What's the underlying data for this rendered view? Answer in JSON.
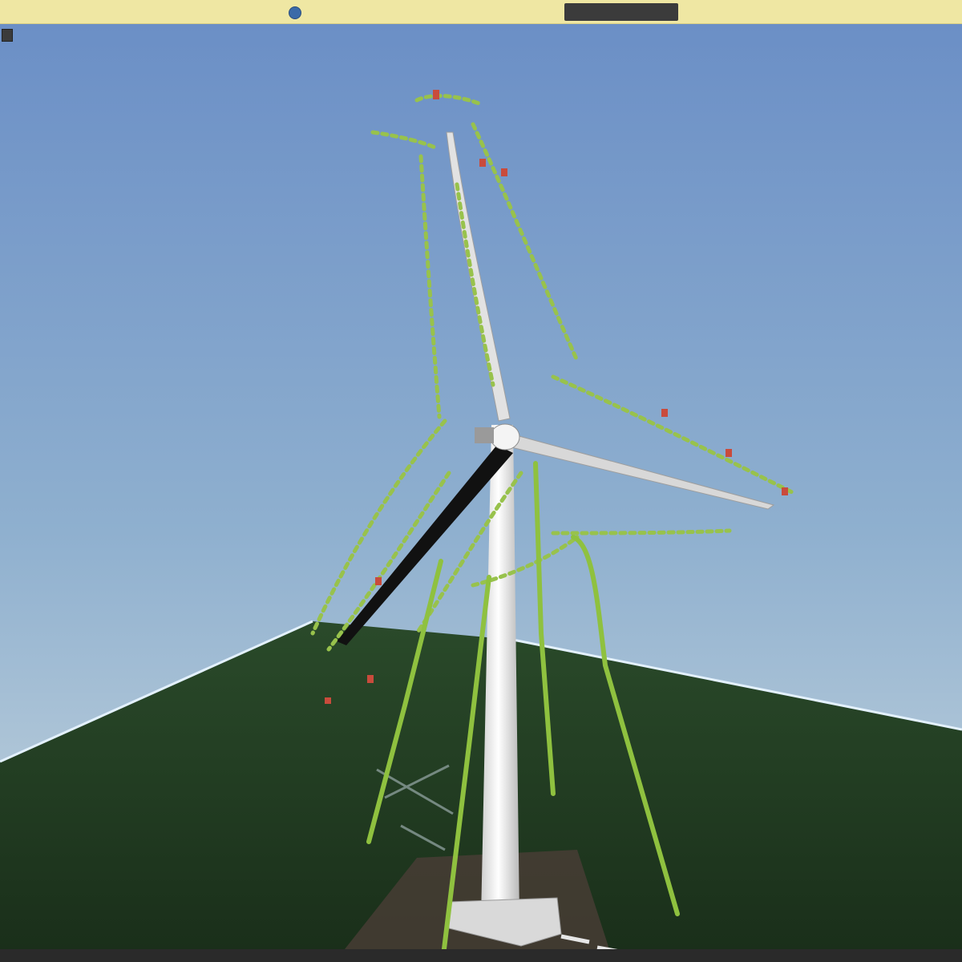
{
  "topbar": {
    "site_text": "",
    "button_label": ""
  },
  "status": {
    "text": ""
  },
  "colors": {
    "sky_top": "#6f91c6",
    "sky_bottom": "#c9d7df",
    "terrain": "#1f3a1f",
    "dots": "#98c24c",
    "dots_alert": "#c94b3c",
    "turbine": "#e8e8e8"
  },
  "icons": {
    "site": "globe-icon"
  }
}
